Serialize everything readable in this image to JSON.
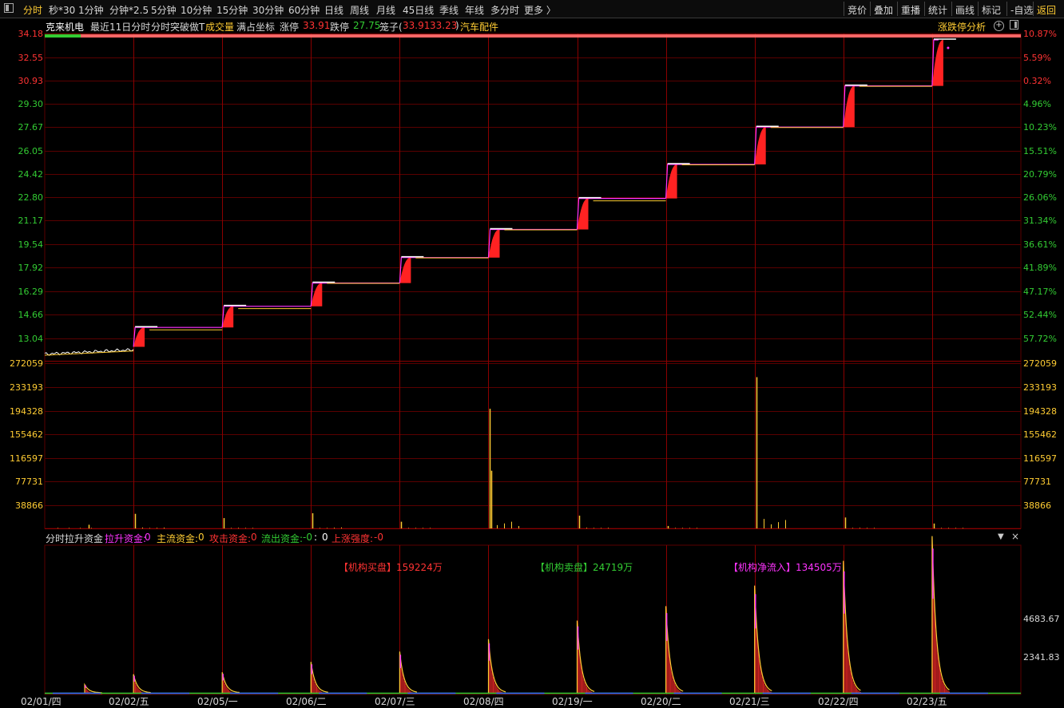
{
  "toolbar": {
    "left": [
      "分时",
      "秒*30",
      "1分钟",
      "分钟*2.5",
      "5分钟",
      "10分钟",
      "15分钟",
      "30分钟",
      "60分钟",
      "日线",
      "周线",
      "月线",
      "45日线",
      "季线",
      "年线",
      "多分时",
      "更多 〉"
    ],
    "right": [
      "竞价",
      "叠加",
      "重播",
      "统计",
      "画线",
      "标记",
      "-自选",
      "返回"
    ]
  },
  "info": {
    "stock_name": "克来机电",
    "period": "最近11日分时",
    "indicator": "分时突破做T",
    "volume_label": "成交量",
    "coord_label": "满占坐标",
    "limit_up_label": "涨停",
    "limit_up_value": "33.91",
    "limit_down_label": "跌停",
    "limit_down_value": "27.75",
    "cage_label": "笼子(",
    "cage_value_1": "33.91",
    "cage_value_2": "33.23",
    "cage_close": ")",
    "sector": "汽车配件",
    "analysis_button": "涨跌停分析"
  },
  "price_axis": {
    "left": [
      "34.18",
      "32.55",
      "30.93",
      "29.30",
      "27.67",
      "26.05",
      "24.42",
      "22.80",
      "21.17",
      "19.54",
      "17.92",
      "16.29",
      "14.66",
      "13.04"
    ],
    "right": [
      "10.87%",
      "5.59%",
      "0.32%",
      "4.96%",
      "10.23%",
      "15.51%",
      "20.79%",
      "26.06%",
      "31.34%",
      "36.61%",
      "41.89%",
      "47.17%",
      "52.44%",
      "57.72%"
    ]
  },
  "volume_axis": [
    "272059",
    "233193",
    "194328",
    "155462",
    "116597",
    "77731",
    "38866"
  ],
  "indicator_panel": {
    "title": "分时拉升资金",
    "items": [
      {
        "label": "拉升资金:",
        "value": "0"
      },
      {
        "label": "主流资金:",
        "value": "0"
      },
      {
        "label": "攻击资金:",
        "value": "0"
      },
      {
        "label": "流出资金:",
        "value": "-0"
      },
      {
        "label": ":",
        "value": "0"
      },
      {
        "label": "上涨强度:",
        "value": "-0"
      }
    ],
    "axis": [
      "4683.67",
      "2341.83"
    ],
    "buy": "【机构买盘】159224万",
    "sell": "【机构卖盘】24719万",
    "net": "【机构净流入】134505万"
  },
  "dates": [
    "02/01/四",
    "02/02/五",
    "02/05/一",
    "02/06/二",
    "02/07/三",
    "02/08/四",
    "02/19/一",
    "02/20/二",
    "02/21/三",
    "02/22/四",
    "02/23/五"
  ],
  "colors": {
    "up": "#ff3333",
    "down": "#33cc33",
    "accent": "#ffcc33",
    "magenta": "#ff33ff",
    "grid": "#5a0000"
  },
  "chart_data": {
    "type": "line",
    "title": "",
    "categories": [
      "02/01",
      "02/02",
      "02/05",
      "02/06",
      "02/07",
      "02/08",
      "02/19",
      "02/20",
      "02/21",
      "02/22",
      "02/23"
    ],
    "series": [
      {
        "values": [
          12.55,
          13.04,
          14.36,
          15.8,
          17.38,
          19.11,
          21.02,
          23.13,
          25.44,
          27.98,
          30.78,
          33.91
        ]
      }
    ],
    "volume_peaks": [
      6000,
      24000,
      17000,
      25000,
      11000,
      197000,
      21000,
      4000,
      249000,
      18000,
      8000
    ],
    "indicator_peaks": [
      400,
      900,
      1000,
      1500,
      2000,
      2600,
      3500,
      4200,
      5200,
      6400,
      7600
    ],
    "ylim_price": [
      12.2,
      34.18
    ],
    "ylim_volume": [
      0,
      272059
    ],
    "ylim_indicator": [
      0,
      6500
    ]
  }
}
